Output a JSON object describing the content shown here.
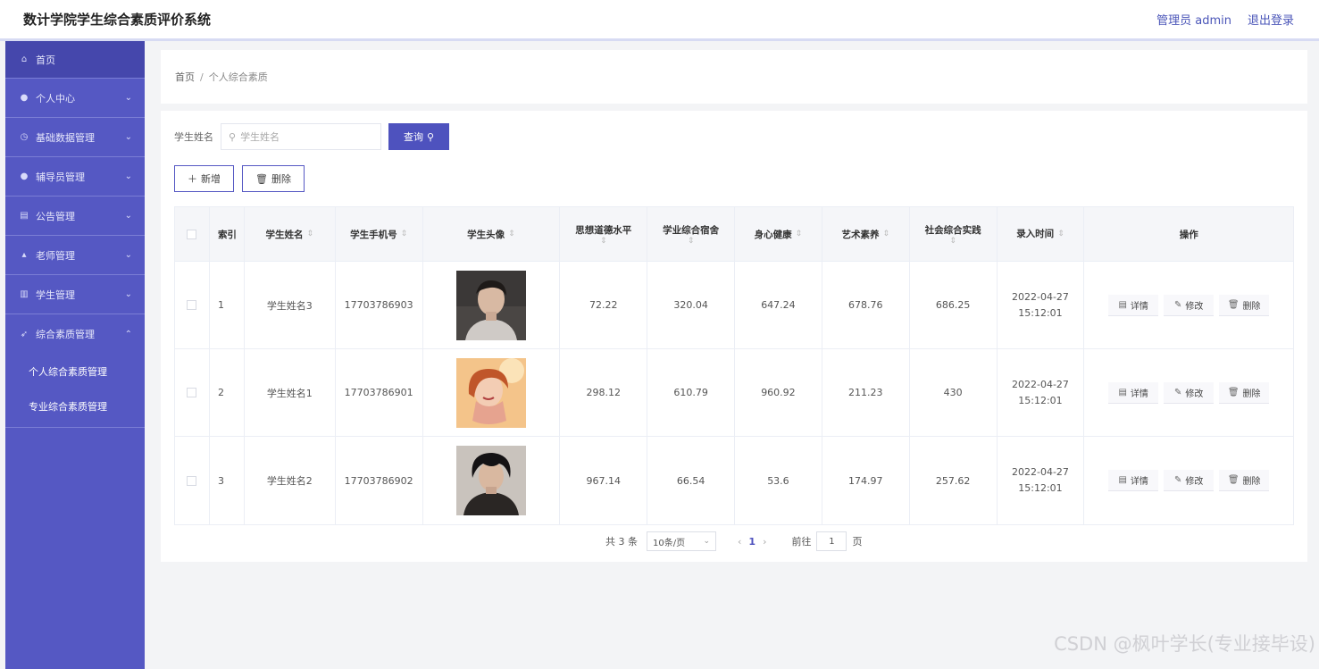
{
  "app": {
    "title": "数计学院学生综合素质评价系统"
  },
  "header": {
    "user": "管理员 admin",
    "logout": "退出登录"
  },
  "sidebar": {
    "items": [
      {
        "label": "首页",
        "icon": "home-icon"
      },
      {
        "label": "个人中心",
        "icon": "user-icon"
      },
      {
        "label": "基础数据管理",
        "icon": "clock-icon"
      },
      {
        "label": "辅导员管理",
        "icon": "user-icon"
      },
      {
        "label": "公告管理",
        "icon": "document-icon"
      },
      {
        "label": "老师管理",
        "icon": "thumb-icon"
      },
      {
        "label": "学生管理",
        "icon": "bank-icon"
      },
      {
        "label": "综合素质管理",
        "icon": "send-icon"
      }
    ],
    "subitems": [
      {
        "label": "个人综合素质管理"
      },
      {
        "label": "专业综合素质管理"
      }
    ]
  },
  "breadcrumb": {
    "home": "首页",
    "separator": "/",
    "current": "个人综合素质"
  },
  "search": {
    "label": "学生姓名",
    "placeholder": "学生姓名",
    "button": "查询"
  },
  "toolbar": {
    "add": "新增",
    "delete": "删除"
  },
  "table": {
    "columns": {
      "index": "索引",
      "name": "学生姓名",
      "phone": "学生手机号",
      "avatar": "学生头像",
      "moral": "思想道德水平",
      "study": "学业综合宿舍",
      "health": "身心健康",
      "art": "艺术素养",
      "social": "社会综合实践",
      "time": "录入时间",
      "ops": "操作"
    },
    "rows": [
      {
        "index": "1",
        "name": "学生姓名3",
        "phone": "17703786903",
        "moral": "72.22",
        "study": "320.04",
        "health": "647.24",
        "art": "678.76",
        "social": "686.25",
        "time": "2022-04-27 15:12:01"
      },
      {
        "index": "2",
        "name": "学生姓名1",
        "phone": "17703786901",
        "moral": "298.12",
        "study": "610.79",
        "health": "960.92",
        "art": "211.23",
        "social": "430",
        "time": "2022-04-27 15:12:01"
      },
      {
        "index": "3",
        "name": "学生姓名2",
        "phone": "17703786902",
        "moral": "967.14",
        "study": "66.54",
        "health": "53.6",
        "art": "174.97",
        "social": "257.62",
        "time": "2022-04-27 15:12:01"
      }
    ],
    "actions": {
      "detail": "详情",
      "edit": "修改",
      "delete": "删除"
    }
  },
  "pagination": {
    "total": "共 3 条",
    "page_size": "10条/页",
    "current_page": "1",
    "goto_label": "前往",
    "goto_value": "1",
    "page_suffix": "页"
  },
  "watermark": "CSDN @枫叶学长(专业接毕设)",
  "colors": {
    "sidebar": "#5558c3",
    "accent": "#4e52be"
  }
}
